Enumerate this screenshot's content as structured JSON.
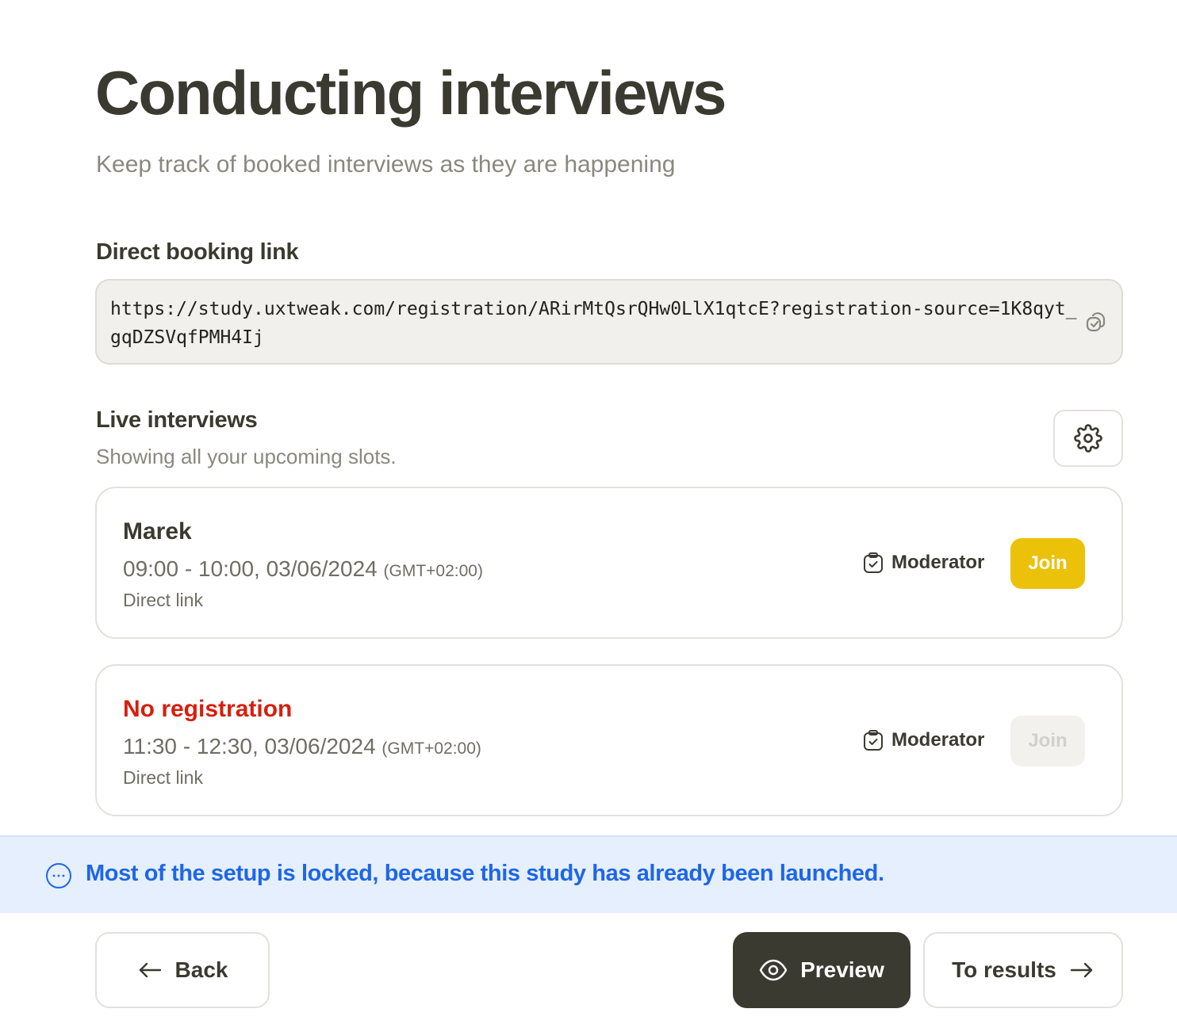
{
  "header": {
    "title": "Conducting interviews",
    "subtitle": "Keep track of booked interviews as they are happening"
  },
  "booking": {
    "title": "Direct booking link",
    "url": "https://study.uxtweak.com/registration/ARirMtQsrQHw0LlX1qtcE?registration-source=1K8qyt_gqDZSVqfPMH4Ij",
    "copy_icon": "copy-icon"
  },
  "live": {
    "title": "Live interviews",
    "subtitle": "Showing all your upcoming slots.",
    "settings_icon": "gear-icon",
    "slots": [
      {
        "name": "Marek",
        "time": "09:00 - 10:00, 03/06/2024",
        "timezone": "(GMT+02:00)",
        "source": "Direct link",
        "role": "Moderator",
        "join_label": "Join",
        "join_enabled": true
      },
      {
        "name": "No registration",
        "time": "11:30 - 12:30, 03/06/2024",
        "timezone": "(GMT+02:00)",
        "source": "Direct link",
        "role": "Moderator",
        "join_label": "Join",
        "join_enabled": false
      }
    ]
  },
  "banner": {
    "text": "Most of the setup is locked, because this study has already been launched.",
    "icon": "info-dots-icon"
  },
  "footer": {
    "back_label": "Back",
    "preview_label": "Preview",
    "results_label": "To results"
  },
  "colors": {
    "text_dark": "#3b3a30",
    "accent_yellow": "#ecc10a",
    "alert_red": "#d61f0e",
    "info_blue": "#1e66e8",
    "info_bg": "#e6effd"
  }
}
